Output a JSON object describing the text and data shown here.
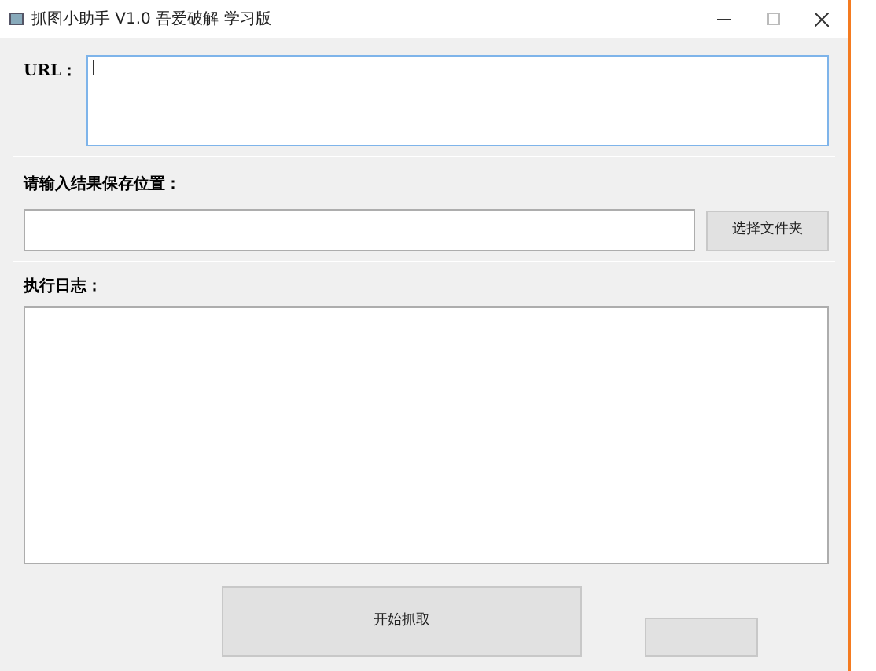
{
  "window": {
    "title": "抓图小助手 V1.0 吾爱破解 学习版"
  },
  "url": {
    "label": "URL：",
    "focused": true
  },
  "save": {
    "label": "请输入结果保存位置：",
    "button": "选择文件夹"
  },
  "log": {
    "label": "执行日志："
  },
  "buttons": [
    {
      "label": "开始抓取"
    }
  ]
}
